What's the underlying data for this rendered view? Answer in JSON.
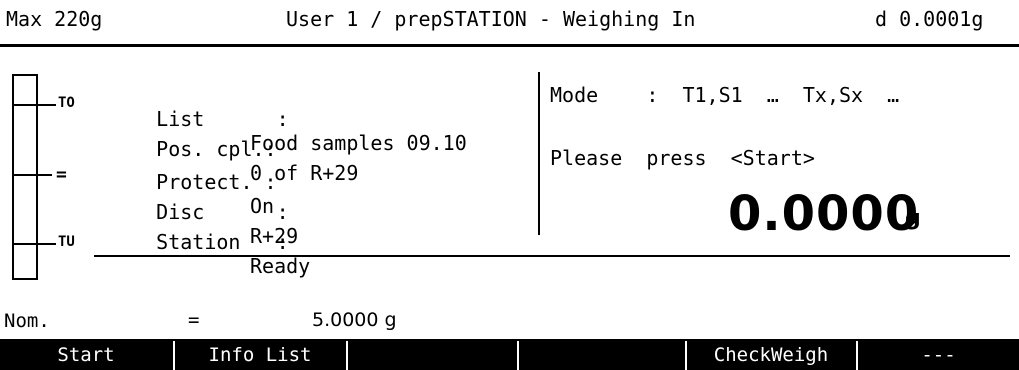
{
  "header": {
    "max_capacity": "Max 220g",
    "title": "User 1 / prepSTATION - Weighing In",
    "readability": "d 0.0001g"
  },
  "tolerance_bar": {
    "upper_label": "TO",
    "middle_label": "=",
    "lower_label": "TU"
  },
  "info": {
    "list_label": "List      :",
    "list_value": "Food samples 09.10",
    "pos_label": "Pos. cpl.:",
    "pos_value": "0  of  R+29",
    "protect_label": "Protect. :",
    "protect_value": "On",
    "disc_label": "Disc      :",
    "disc_value": "R+29",
    "station_label": "Station   :",
    "station_value": "Ready"
  },
  "mode": {
    "text": "Mode    :  T1,S1  …  Tx,Sx  …"
  },
  "prompt": "Please  press  <Start>",
  "weight": {
    "value": "0.0000",
    "unit": "g"
  },
  "nominal": {
    "label": "Nom.",
    "equals": "=",
    "value": "5.0000 g"
  },
  "softkeys": [
    "Start",
    "Info List",
    "",
    "",
    "CheckWeigh",
    "---"
  ]
}
